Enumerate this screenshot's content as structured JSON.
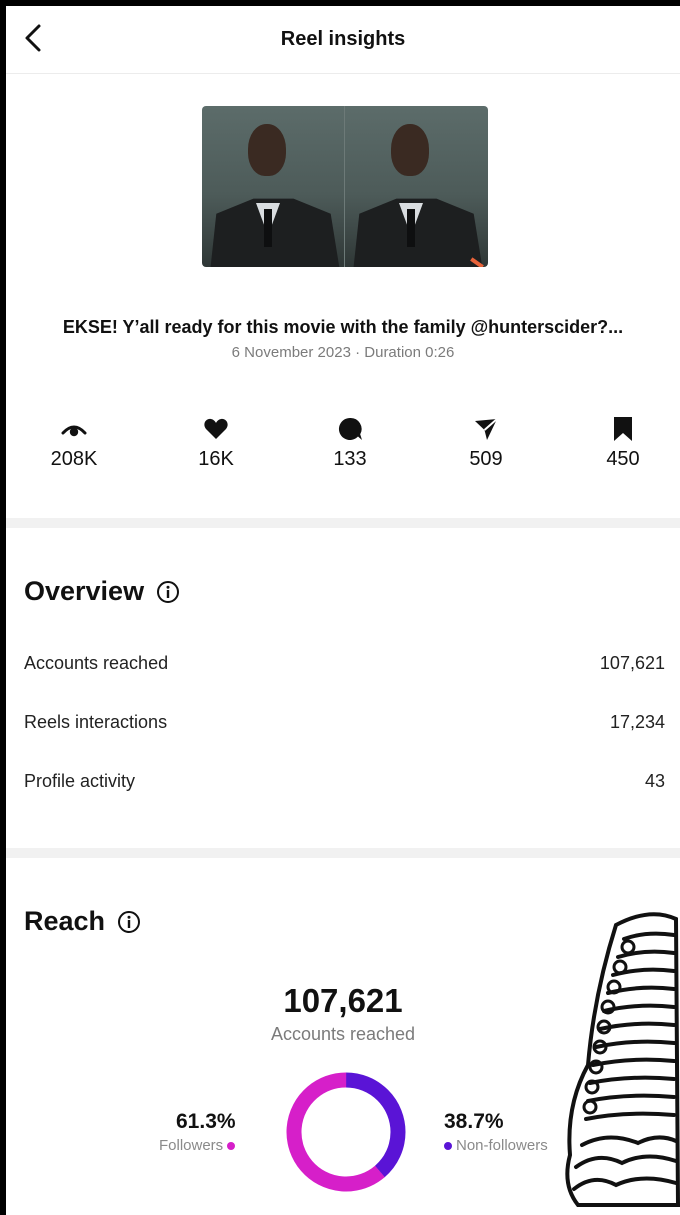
{
  "header": {
    "title": "Reel insights",
    "back_icon": "chevron-left-icon"
  },
  "reel": {
    "caption": "EKSE! Y’all ready for this movie with the family @hunterscider?...",
    "date": "6 November 2023",
    "duration": "Duration 0:26",
    "meta_separator": " · "
  },
  "stats": [
    {
      "icon": "eye-icon",
      "value": "208K"
    },
    {
      "icon": "heart-icon",
      "value": "16K"
    },
    {
      "icon": "comment-icon",
      "value": "133"
    },
    {
      "icon": "share-icon",
      "value": "509"
    },
    {
      "icon": "bookmark-icon",
      "value": "450"
    }
  ],
  "overview": {
    "title": "Overview",
    "rows": [
      {
        "label": "Accounts reached",
        "value": "107,621"
      },
      {
        "label": "Reels interactions",
        "value": "17,234"
      },
      {
        "label": "Profile activity",
        "value": "43"
      }
    ]
  },
  "reach": {
    "title": "Reach",
    "total": "107,621",
    "total_label": "Accounts reached",
    "followers_pct": "61.3%",
    "followers_label": "Followers",
    "non_followers_pct": "38.7%",
    "non_followers_label": "Non-followers",
    "followers_fraction": 0.613,
    "followers_color": "#d61fc9",
    "non_followers_color": "#5a14d6"
  }
}
